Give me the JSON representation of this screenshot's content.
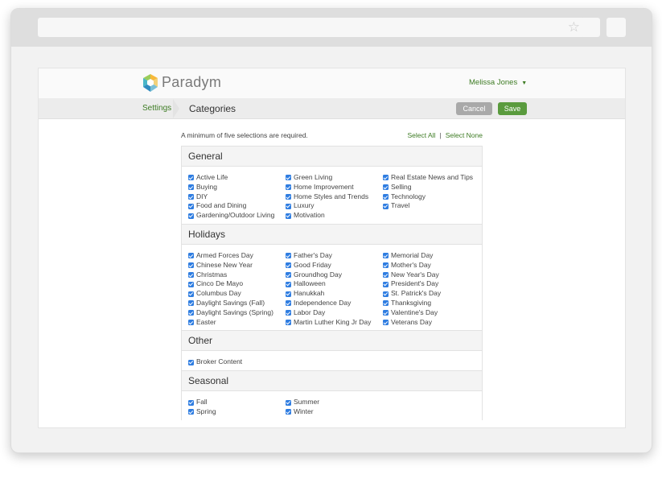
{
  "app": {
    "brand": "Paradym",
    "user_name": "Melissa Jones",
    "breadcrumb": "Settings",
    "page_title": "Categories",
    "cancel_label": "Cancel",
    "save_label": "Save"
  },
  "content": {
    "note": "A minimum of five selections are required.",
    "select_all": "Select All",
    "separator": "|",
    "select_none": "Select None"
  },
  "sections": [
    {
      "title": "General",
      "columns": [
        [
          "Active Life",
          "Buying",
          "DIY",
          "Food and Dining",
          "Gardening/Outdoor Living"
        ],
        [
          "Green Living",
          "Home Improvement",
          "Home Styles and Trends",
          "Luxury",
          "Motivation"
        ],
        [
          "Real Estate News and Tips",
          "Selling",
          "Technology",
          "Travel"
        ]
      ]
    },
    {
      "title": "Holidays",
      "columns": [
        [
          "Armed Forces Day",
          "Chinese New Year",
          "Christmas",
          "Cinco De Mayo",
          "Columbus Day",
          "Daylight Savings (Fall)",
          "Daylight Savings (Spring)",
          "Easter"
        ],
        [
          "Father's Day",
          "Good Friday",
          "Groundhog Day",
          "Halloween",
          "Hanukkah",
          "Independence Day",
          "Labor Day",
          "Martin Luther King Jr Day"
        ],
        [
          "Memorial Day",
          "Mother's Day",
          "New Year's Day",
          "President's Day",
          "St. Patrick's Day",
          "Thanksgiving",
          "Valentine's Day",
          "Veterans Day"
        ]
      ]
    },
    {
      "title": "Other",
      "columns": [
        [
          "Broker Content"
        ]
      ]
    },
    {
      "title": "Seasonal",
      "columns": [
        [
          "Fall",
          "Spring"
        ],
        [
          "Summer",
          "Winter"
        ]
      ]
    }
  ],
  "colors": {
    "accent_green": "#3e7c24",
    "save_button": "#5a9b3e",
    "cancel_button": "#a9a9a9",
    "checkbox": "#2f7de1"
  }
}
